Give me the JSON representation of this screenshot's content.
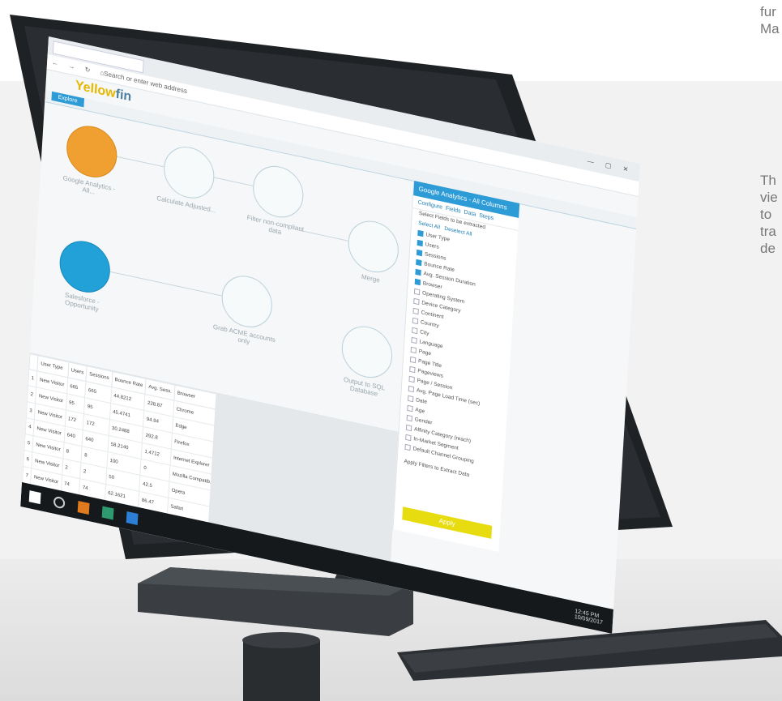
{
  "side_text": {
    "top": [
      "fur",
      "Ma"
    ],
    "middle": [
      "Th",
      "vie",
      "to",
      "tra",
      "de"
    ]
  },
  "app": {
    "brand_a": "Yellow",
    "brand_b": "fin",
    "address_placeholder": "Search or enter web address",
    "app_tab": "Explore"
  },
  "nodes": [
    {
      "label": "Google Analytics - All..."
    },
    {
      "label": "Calculate Adjusted..."
    },
    {
      "label": "Filter non-compliant data"
    },
    {
      "label": "Merge"
    },
    {
      "label": "Salesforce - Opportunity"
    },
    {
      "label": "Grab ACME accounts only"
    },
    {
      "label": "Output to SQL Database"
    }
  ],
  "panel": {
    "title": "Google Analytics - All Columns",
    "tabs": [
      "Configure",
      "Fields",
      "Data",
      "Steps"
    ],
    "prompt": "Select Fields to be extracted",
    "select_all": "Select All",
    "deselect_all": "Deselect All",
    "fields": [
      {
        "name": "User Type",
        "checked": true
      },
      {
        "name": "Users",
        "checked": true
      },
      {
        "name": "Sessions",
        "checked": true
      },
      {
        "name": "Bounce Rate",
        "checked": true
      },
      {
        "name": "Avg. Session Duration",
        "checked": true
      },
      {
        "name": "Browser",
        "checked": true
      },
      {
        "name": "Operating System",
        "checked": false
      },
      {
        "name": "Device Category",
        "checked": false
      },
      {
        "name": "Continent",
        "checked": false
      },
      {
        "name": "Country",
        "checked": false
      },
      {
        "name": "City",
        "checked": false
      },
      {
        "name": "Language",
        "checked": false
      },
      {
        "name": "Page",
        "checked": false
      },
      {
        "name": "Page Title",
        "checked": false
      },
      {
        "name": "Pageviews",
        "checked": false
      },
      {
        "name": "Page / Session",
        "checked": false
      },
      {
        "name": "Avg. Page Load Time (sec)",
        "checked": false
      },
      {
        "name": "Date",
        "checked": false
      },
      {
        "name": "Age",
        "checked": false
      },
      {
        "name": "Gender",
        "checked": false
      },
      {
        "name": "Affinity Category (reach)",
        "checked": false
      },
      {
        "name": "In-Market Segment",
        "checked": false
      },
      {
        "name": "Default Channel Grouping",
        "checked": false
      }
    ],
    "filters_label": "Apply Filters to Extract Data",
    "apply": "Apply"
  },
  "grid": {
    "headers": [
      "User Type",
      "Users",
      "Sessions",
      "Bounce Rate",
      "Avg. Sess.",
      "Browser"
    ],
    "rows": [
      [
        "1",
        "New Visitor",
        "665",
        "665",
        "44.8212",
        "228.87",
        "Chrome"
      ],
      [
        "2",
        "New Visitor",
        "95",
        "95",
        "45.4741",
        "94.94",
        "Edge"
      ],
      [
        "3",
        "New Visitor",
        "172",
        "172",
        "30.2488",
        "292.8",
        "Firefox"
      ],
      [
        "4",
        "New Visitor",
        "640",
        "640",
        "58.2140",
        "1.4712",
        "Internet Explorer"
      ],
      [
        "5",
        "New Visitor",
        "8",
        "8",
        "100",
        "0",
        "Mozilla Compatib."
      ],
      [
        "6",
        "New Visitor",
        "2",
        "2",
        "50",
        "42.5",
        "Opera"
      ],
      [
        "7",
        "New Visitor",
        "74",
        "74",
        "62.1621",
        "86.47",
        "Safari"
      ]
    ]
  },
  "taskbar": {
    "time": "12:45 PM",
    "date": "10/09/2017"
  }
}
